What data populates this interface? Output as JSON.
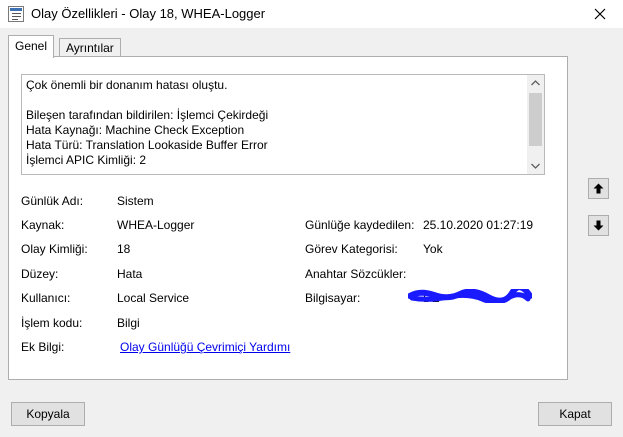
{
  "window": {
    "title": "Olay Özellikleri - Olay 18, WHEA-Logger",
    "close_glyph": "✕"
  },
  "tabs": [
    {
      "label": "Genel",
      "active": true
    },
    {
      "label": "Ayrıntılar",
      "active": false
    }
  ],
  "message": {
    "lines": [
      "Çok önemli bir donanım hatası oluştu.",
      "",
      "Bileşen tarafından bildirilen: İşlemci Çekirdeği",
      "Hata Kaynağı: Machine Check Exception",
      "Hata Türü: Translation Lookaside Buffer Error",
      "İşlemci APIC Kimliği: 2"
    ]
  },
  "fields": {
    "log_name": {
      "label": "Günlük Adı:",
      "value": "Sistem"
    },
    "source": {
      "label": "Kaynak:",
      "value": "WHEA-Logger"
    },
    "logged": {
      "label": "Günlüğe kaydedilen:",
      "value": "25.10.2020 01:27:19"
    },
    "event_id": {
      "label": "Olay Kimliği:",
      "value": "18"
    },
    "task_category": {
      "label": "Görev Kategorisi:",
      "value": "Yok"
    },
    "level": {
      "label": "Düzey:",
      "value": "Hata"
    },
    "keywords": {
      "label": "Anahtar Sözcükler:",
      "value": ""
    },
    "user": {
      "label": "Kullanıcı:",
      "value": "Local Service"
    },
    "computer": {
      "label": "Bilgisayar:",
      "value": "DE"
    },
    "opcode": {
      "label": "İşlem kodu:",
      "value": "Bilgi"
    },
    "more_info": {
      "label": "Ek Bilgi:",
      "link": "Olay Günlüğü Çevrimiçi Yardımı"
    }
  },
  "buttons": {
    "copy": "Kopyala",
    "close": "Kapat"
  },
  "icons": {
    "nav_up": "arrow-up-icon",
    "nav_down": "arrow-down-icon",
    "window": "event-viewer-icon"
  },
  "colors": {
    "link": "#0000ee",
    "redaction": "#1a1aff"
  }
}
